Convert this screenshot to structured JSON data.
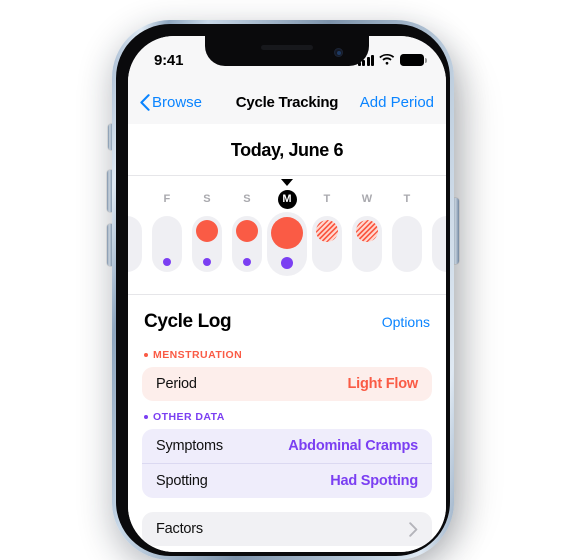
{
  "status_bar": {
    "time": "9:41",
    "cellular_icon": "cellular-bars-icon",
    "wifi_icon": "wifi-icon",
    "battery_icon": "battery-full-icon"
  },
  "nav_bar": {
    "back_icon": "chevron-left-icon",
    "back_label": "Browse",
    "title": "Cycle Tracking",
    "action_label": "Add Period"
  },
  "calendar": {
    "today_header": "Today, June 6",
    "today_pointer_icon": "triangle-down-icon",
    "days": [
      {
        "letter": "",
        "is_today": false,
        "flow": "none",
        "symptom": false,
        "edge": true
      },
      {
        "letter": "F",
        "is_today": false,
        "flow": "none",
        "symptom": true,
        "edge": false
      },
      {
        "letter": "S",
        "is_today": false,
        "flow": "logged",
        "symptom": true,
        "edge": false
      },
      {
        "letter": "S",
        "is_today": false,
        "flow": "logged",
        "symptom": true,
        "edge": false
      },
      {
        "letter": "M",
        "is_today": true,
        "flow": "logged",
        "symptom": true,
        "edge": false
      },
      {
        "letter": "T",
        "is_today": false,
        "flow": "predicted",
        "symptom": false,
        "edge": false
      },
      {
        "letter": "W",
        "is_today": false,
        "flow": "predicted",
        "symptom": false,
        "edge": false
      },
      {
        "letter": "T",
        "is_today": false,
        "flow": "none",
        "symptom": false,
        "edge": false
      },
      {
        "letter": "",
        "is_today": false,
        "flow": "none",
        "symptom": false,
        "edge": true
      }
    ]
  },
  "cycle_log": {
    "title": "Cycle Log",
    "options_label": "Options",
    "sections": [
      {
        "label": "MENSTRUATION",
        "accent": "#FA5B45",
        "rows": [
          {
            "label": "Period",
            "value": "Light Flow",
            "value_color": "red"
          }
        ]
      },
      {
        "label": "OTHER DATA",
        "accent": "#7B3FF2",
        "rows": [
          {
            "label": "Symptoms",
            "value": "Abdominal Cramps",
            "value_color": "purple"
          },
          {
            "label": "Spotting",
            "value": "Had Spotting",
            "value_color": "purple"
          }
        ]
      }
    ],
    "factors_row": {
      "label": "Factors",
      "chevron_icon": "chevron-right-icon"
    }
  },
  "colors": {
    "period_red": "#FA5B45",
    "symptom_purple": "#7B3FF2",
    "link_blue": "#0A84FF",
    "capsule_gray": "#EFEFF3",
    "card_pink": "#FDEEEB",
    "card_lavender": "#EFEDFB",
    "card_gray": "#F1F1F4"
  }
}
